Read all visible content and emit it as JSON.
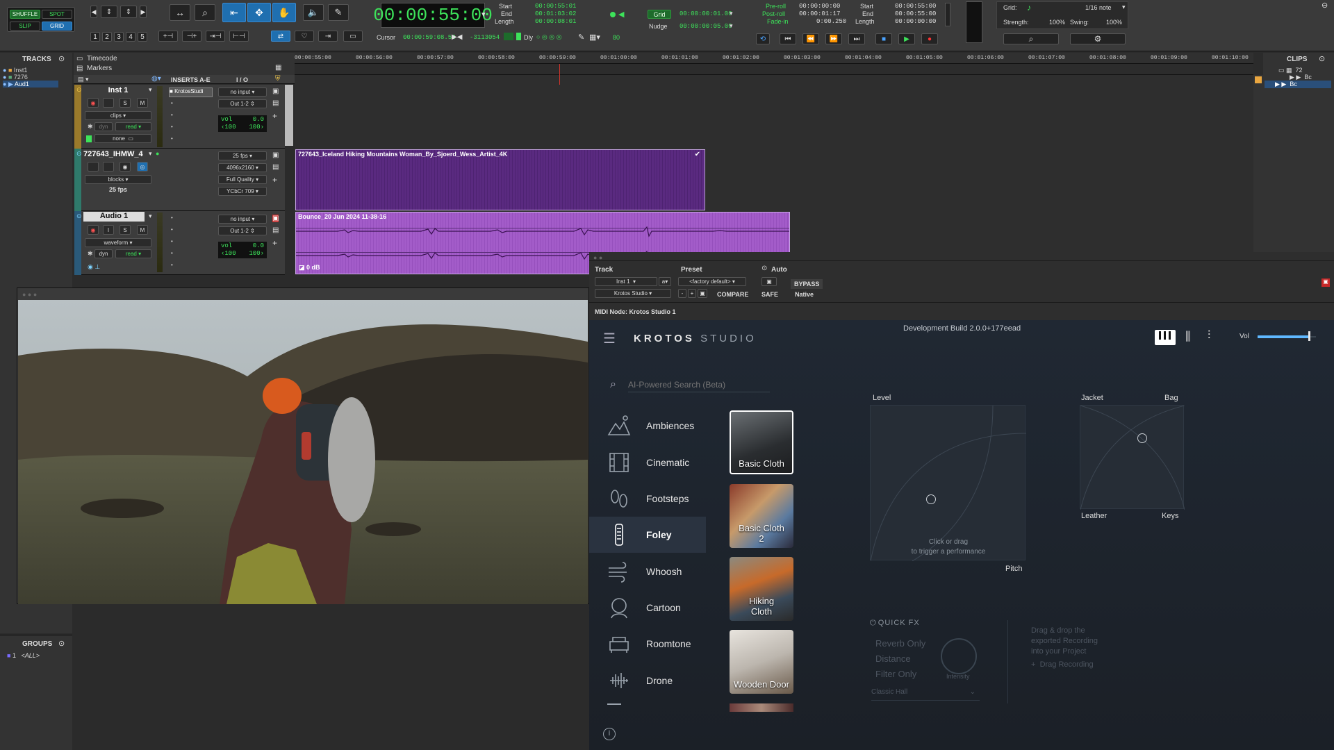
{
  "toolbar": {
    "edit_modes": [
      "SHUFFLE",
      "SPOT",
      "SLIP",
      "GRID"
    ],
    "zoom_presets": [
      "1",
      "2",
      "3",
      "4",
      "5"
    ],
    "main_counter": "00:00:55:00",
    "selection": {
      "start_label": "Start",
      "end_label": "End",
      "length_label": "Length",
      "start": "00:00:55:01",
      "end": "00:01:03:02",
      "length": "00:00:08:01"
    },
    "cursor_label": "Cursor",
    "cursor": "00:00:59:08.53",
    "sample": "-3113054",
    "dly_label": "Dly",
    "dly_value": "80",
    "grid_label": "Grid",
    "grid_value": "00:00:00:01.00",
    "nudge_label": "Nudge",
    "nudge_value": "00:00:00:05.00",
    "preroll_label": "Pre-roll",
    "preroll": "00:00:00:00",
    "postroll_label": "Post-roll",
    "postroll": "00:00:01:17",
    "fadein_label": "Fade-in",
    "fadein": "0:00.250",
    "transport_start": "00:00:55:00",
    "transport_end": "00:00:55:00",
    "transport_length": "00:00:00:00",
    "grid_right_label": "Grid:",
    "grid_right_value": "1/16 note",
    "strength_label": "Strength:",
    "strength": "100%",
    "swing_label": "Swing:",
    "swing": "100%"
  },
  "tracks_panel": {
    "title": "TRACKS",
    "items": [
      "Inst1",
      "7276",
      "Aud1"
    ]
  },
  "groups_panel": {
    "title": "GROUPS",
    "items": [
      "1",
      "<ALL>"
    ]
  },
  "clips_panel": {
    "title": "CLIPS",
    "items": [
      "72",
      "Bc",
      "Bc"
    ]
  },
  "ruler": {
    "timecode_label": "Timecode",
    "markers_label": "Markers",
    "ticks": [
      "00:00:55:00",
      "00:00:56:00",
      "00:00:57:00",
      "00:00:58:00",
      "00:00:59:00",
      "00:01:00:00",
      "00:01:01:00",
      "00:01:02:00",
      "00:01:03:00",
      "00:01:04:00",
      "00:01:05:00",
      "00:01:06:00",
      "00:01:07:00",
      "00:01:08:00",
      "00:01:09:00",
      "00:01:10:00"
    ]
  },
  "column_heads": {
    "inserts": "INSERTS A-E",
    "io": "I / O"
  },
  "tracks": [
    {
      "name": "Inst 1",
      "mode": "clips",
      "auto": "read",
      "insert": "KrotosStudi",
      "input": "no input",
      "output": "Out 1-2",
      "vol_label": "vol",
      "vol": "0.0",
      "pan_l": "‹100",
      "pan_r": "100›",
      "extra": "none",
      "dyn": "dyn"
    },
    {
      "name": "727643_IHMW_4",
      "mode": "blocks",
      "fps": "25 fps",
      "fps_sel": "25 fps",
      "res": "4096x2160",
      "quality": "Full Quality",
      "color": "YCbCr 709"
    },
    {
      "name": "Audio 1",
      "mode": "waveform",
      "auto": "read",
      "input": "no input",
      "output": "Out 1-2",
      "vol_label": "vol",
      "vol": "0.0",
      "pan_l": "‹100",
      "pan_r": "100›",
      "dyn": "dyn"
    }
  ],
  "clips": {
    "video_clip": "727643_Iceland Hiking Mountains Woman_By_Sjoerd_Wess_Artist_4K",
    "audio_clip": "Bounce_20 Jun 2024 11-38-16",
    "audio_gain": "0 dB"
  },
  "plugin_header": {
    "track_label": "Track",
    "preset_label": "Preset",
    "auto_label": "Auto",
    "track_value": "Inst 1",
    "track_suffix": "a",
    "preset_value": "<factory default>",
    "plugin_value": "Krotos Studio",
    "compare": "COMPARE",
    "bypass": "BYPASS",
    "safe": "SAFE",
    "native": "Native",
    "midi_node": "MIDI Node: Krotos Studio 1"
  },
  "krotos": {
    "logo_bold": "KROTOS",
    "logo_light": "STUDIO",
    "build": "Development Build 2.0.0+177eead",
    "vol_label": "Vol",
    "vol_level": 0.88,
    "search_placeholder": "AI-Powered Search (Beta)",
    "categories": [
      "Ambiences",
      "Cinematic",
      "Footsteps",
      "Foley",
      "Whoosh",
      "Cartoon",
      "Roomtone",
      "Drone"
    ],
    "active_category": "Foley",
    "presets": [
      {
        "line1": "Basic Cloth",
        "line2": "",
        "selected": true
      },
      {
        "line1": "Basic Cloth",
        "line2": "2",
        "selected": false
      },
      {
        "line1": "Hiking",
        "line2": "Cloth",
        "selected": false
      },
      {
        "line1": "Wooden Door",
        "line2": "",
        "selected": false
      }
    ],
    "level_label": "Level",
    "pitch_label": "Pitch",
    "pad_hint_1": "Click or drag",
    "pad_hint_2": "to trigger a performance",
    "xy_labels": {
      "tl": "Jacket",
      "tr": "Bag",
      "bl": "Leather",
      "br": "Keys"
    },
    "quickfx": {
      "title": "QUICK FX",
      "options": [
        "Reverb Only",
        "Distance",
        "Filter Only"
      ],
      "knob_label": "Intensity",
      "select": "Classic Hall"
    },
    "drag": {
      "line1": "Drag & drop the",
      "line2": "exported Recording",
      "line3": "into your Project",
      "button": "Drag Recording"
    }
  }
}
